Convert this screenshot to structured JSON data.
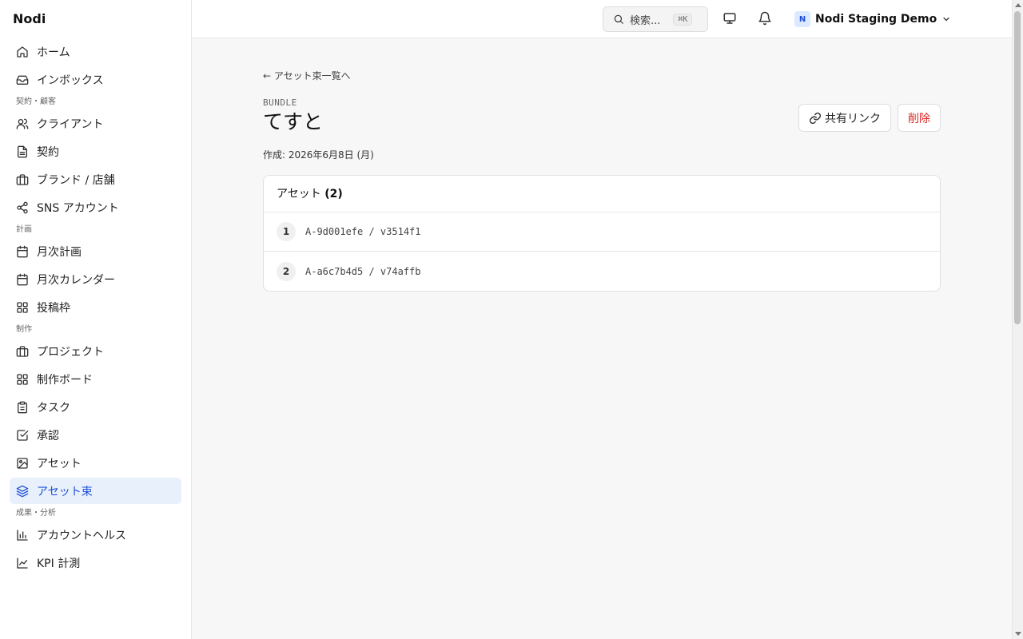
{
  "app": {
    "logo": "Nodi"
  },
  "sidebar": {
    "items_top": [
      {
        "label": "ホーム",
        "icon": "home-icon"
      },
      {
        "label": "インボックス",
        "icon": "inbox-icon"
      }
    ],
    "sections": [
      {
        "label": "契約・顧客",
        "items": [
          {
            "label": "クライアント",
            "icon": "users-icon"
          },
          {
            "label": "契約",
            "icon": "file-text-icon"
          },
          {
            "label": "ブランド / 店舗",
            "icon": "briefcase-icon"
          },
          {
            "label": "SNS アカウント",
            "icon": "share-icon"
          }
        ]
      },
      {
        "label": "計画",
        "items": [
          {
            "label": "月次計画",
            "icon": "calendar-icon"
          },
          {
            "label": "月次カレンダー",
            "icon": "calendar-icon"
          },
          {
            "label": "投稿枠",
            "icon": "grid-icon"
          }
        ]
      },
      {
        "label": "制作",
        "items": [
          {
            "label": "プロジェクト",
            "icon": "briefcase-icon"
          },
          {
            "label": "制作ボード",
            "icon": "grid-icon"
          },
          {
            "label": "タスク",
            "icon": "clipboard-icon"
          },
          {
            "label": "承認",
            "icon": "check-square-icon"
          },
          {
            "label": "アセット",
            "icon": "image-icon"
          },
          {
            "label": "アセット束",
            "icon": "layers-icon",
            "active": true
          }
        ]
      },
      {
        "label": "成果・分析",
        "items": [
          {
            "label": "アカウントヘルス",
            "icon": "bar-chart-icon"
          },
          {
            "label": "KPI 計測",
            "icon": "line-chart-icon"
          }
        ]
      }
    ]
  },
  "topbar": {
    "search_label": "検索...",
    "search_shortcut": "⌘K",
    "workspace_badge": "N",
    "workspace_name": "Nodi Staging Demo"
  },
  "page": {
    "back_link": "← アセット束一覧へ",
    "eyebrow": "BUNDLE",
    "title": "てすと",
    "created": "作成: 2026年6月8日 (月)",
    "share_button": "共有リンク",
    "delete_button": "削除"
  },
  "assets_card": {
    "title": "アセット",
    "count": "(2)",
    "rows": [
      {
        "num": "1",
        "text": "A-9d001efe / v3514f1"
      },
      {
        "num": "2",
        "text": "A-a6c7b4d5 / v74affb"
      }
    ]
  },
  "colors": {
    "accent": "#1d4ed8",
    "active_bg": "#e8f1fb",
    "danger": "#dc2626"
  }
}
